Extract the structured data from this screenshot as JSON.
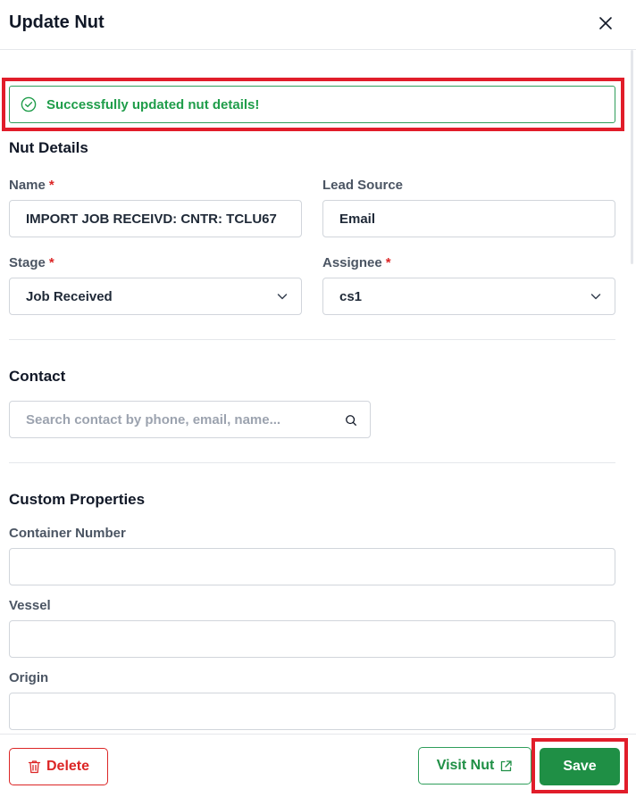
{
  "dialog": {
    "title": "Update Nut"
  },
  "alert": {
    "message": "Successfully updated nut details!"
  },
  "nut_details": {
    "section_title": "Nut Details",
    "name": {
      "label": "Name",
      "required_mark": "*",
      "value": "IMPORT JOB RECEIVD: CNTR: TCLU67"
    },
    "lead_source": {
      "label": "Lead Source",
      "value": "Email"
    },
    "stage": {
      "label": "Stage",
      "required_mark": "*",
      "value": "Job Received"
    },
    "assignee": {
      "label": "Assignee",
      "required_mark": "*",
      "value": "cs1"
    }
  },
  "contact": {
    "section_title": "Contact",
    "search_placeholder": "Search contact by phone, email, name..."
  },
  "custom_properties": {
    "section_title": "Custom Properties",
    "container_number": {
      "label": "Container Number",
      "value": ""
    },
    "vessel": {
      "label": "Vessel",
      "value": ""
    },
    "origin": {
      "label": "Origin",
      "value": ""
    }
  },
  "footer": {
    "delete_label": "Delete",
    "visit_label": "Visit Nut",
    "save_label": "Save"
  },
  "colors": {
    "success": "#1f9d4a",
    "danger": "#dc2626",
    "primary": "#1f8f45",
    "highlight": "#e11d2a"
  },
  "icons": [
    "close-icon",
    "check-circle-icon",
    "chevron-down-icon",
    "search-icon",
    "trash-icon",
    "external-link-icon"
  ]
}
